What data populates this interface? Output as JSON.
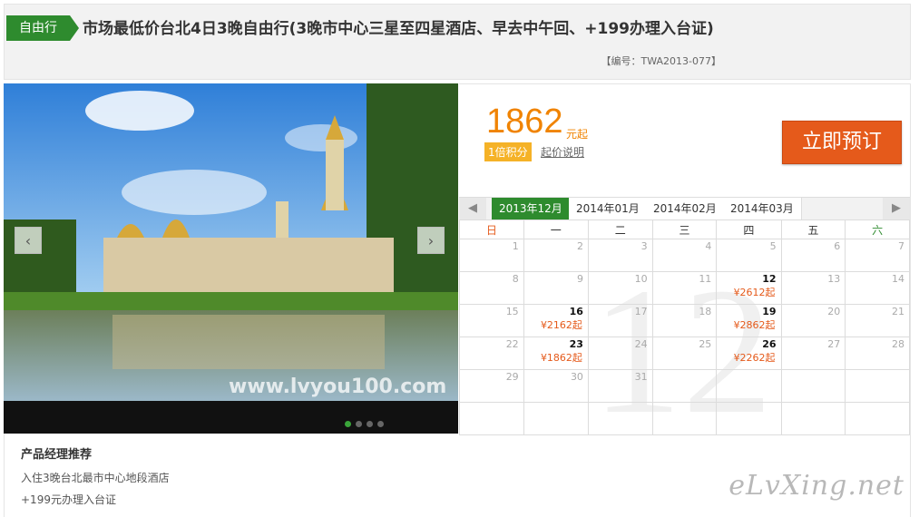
{
  "header": {
    "tag": "自由行",
    "title": "市场最低价台北4日3晚自由行(3晚市中心三星至四星酒店、早去中午回、+199办理入台证)",
    "code": "【编号：TWA2013-077】"
  },
  "photo": {
    "watermark": "www.lvyou100.com",
    "prev_icon": "chevron-left-icon",
    "next_icon": "chevron-right-icon",
    "slide_count": 4,
    "active_slide": 1
  },
  "booking": {
    "price": "1862",
    "price_unit": "元起",
    "points_badge": "1倍积分",
    "price_explain": "起价说明",
    "book_button": "立即预订"
  },
  "calendar": {
    "months": [
      "2013年12月",
      "2014年01月",
      "2014年02月",
      "2014年03月"
    ],
    "active_month": 0,
    "weekdays": [
      "日",
      "一",
      "二",
      "三",
      "四",
      "五",
      "六"
    ],
    "background_number": "12",
    "weeks": [
      [
        {
          "d": "1"
        },
        {
          "d": "2"
        },
        {
          "d": "3"
        },
        {
          "d": "4"
        },
        {
          "d": "5"
        },
        {
          "d": "6"
        },
        {
          "d": "7"
        }
      ],
      [
        {
          "d": "8"
        },
        {
          "d": "9"
        },
        {
          "d": "10"
        },
        {
          "d": "11"
        },
        {
          "d": "12",
          "p": "¥2612起"
        },
        {
          "d": "13"
        },
        {
          "d": "14"
        }
      ],
      [
        {
          "d": "15"
        },
        {
          "d": "16",
          "p": "¥2162起"
        },
        {
          "d": "17"
        },
        {
          "d": "18"
        },
        {
          "d": "19",
          "p": "¥2862起"
        },
        {
          "d": "20"
        },
        {
          "d": "21"
        }
      ],
      [
        {
          "d": "22"
        },
        {
          "d": "23",
          "p": "¥1862起"
        },
        {
          "d": "24"
        },
        {
          "d": "25"
        },
        {
          "d": "26",
          "p": "¥2262起"
        },
        {
          "d": "27"
        },
        {
          "d": "28"
        }
      ],
      [
        {
          "d": "29"
        },
        {
          "d": "30"
        },
        {
          "d": "31"
        },
        {
          "d": ""
        },
        {
          "d": ""
        },
        {
          "d": ""
        },
        {
          "d": ""
        }
      ],
      [
        {
          "d": ""
        },
        {
          "d": ""
        },
        {
          "d": ""
        },
        {
          "d": ""
        },
        {
          "d": ""
        },
        {
          "d": ""
        },
        {
          "d": ""
        }
      ]
    ]
  },
  "recommend": {
    "title": "产品经理推荐",
    "items": [
      "入住3晚台北最市中心地段酒店",
      "+199元办理入台证"
    ]
  },
  "site_watermark": "eLvXing.net",
  "colors": {
    "brand_green": "#2e8b2e",
    "accent_orange": "#f08300",
    "book_orange": "#e55a1b"
  }
}
